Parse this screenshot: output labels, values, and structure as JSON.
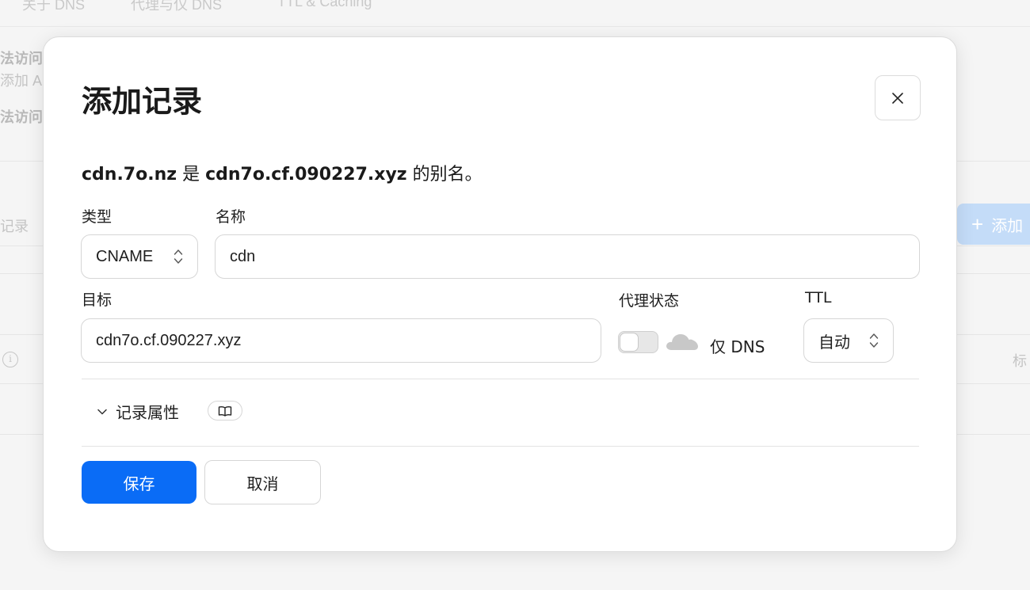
{
  "background": {
    "tabs": [
      "关于 DNS",
      "代理与仅 DNS",
      "TTL & Caching"
    ],
    "notice_1_title": "法访问",
    "notice_1_text": "添加 A…",
    "notice_2_title": "法访问",
    "search_placeholder": "记录",
    "add_button_label": "添加",
    "table_header_tag": "标"
  },
  "modal": {
    "title": "添加记录",
    "alias": {
      "name": "cdn.7o.nz",
      "verb": "是",
      "target": "cdn7o.cf.090227.xyz",
      "suffix": "的别名。"
    },
    "type": {
      "label": "类型",
      "value": "CNAME"
    },
    "name": {
      "label": "名称",
      "value": "cdn"
    },
    "target": {
      "label": "目标",
      "value": "cdn7o.cf.090227.xyz"
    },
    "proxy": {
      "label": "代理状态",
      "enabled": false,
      "status_text": "仅 DNS"
    },
    "ttl": {
      "label": "TTL",
      "value": "自动"
    },
    "record_attributes_label": "记录属性",
    "save_label": "保存",
    "cancel_label": "取消"
  },
  "colors": {
    "primary": "#0a6cf6",
    "overlay_button": "#c4dcf8",
    "cloud_disabled": "#c8c8c8"
  },
  "icons": [
    "close-icon",
    "chevron-up-down-icon",
    "cloud-icon",
    "chevron-down-icon",
    "book-icon",
    "plus-icon",
    "info-icon"
  ]
}
